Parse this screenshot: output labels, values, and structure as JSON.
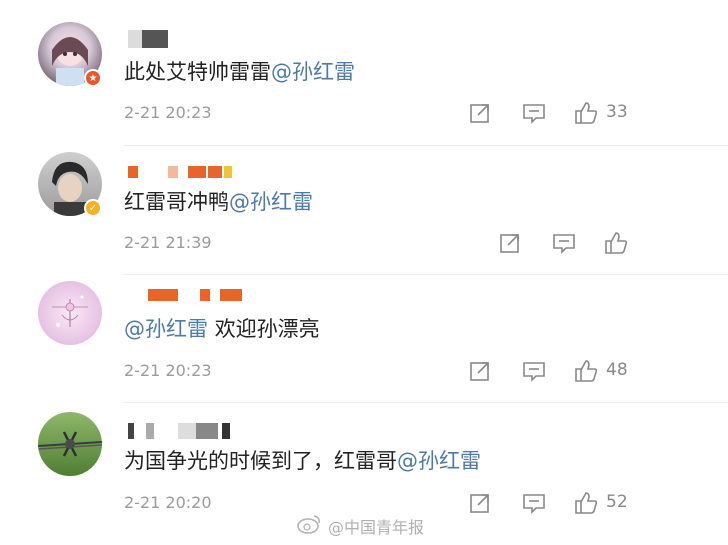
{
  "comments": [
    {
      "text": "此处艾特帅雷雷",
      "mention": "@孙红雷",
      "time": "2-21 20:23",
      "likes": "33"
    },
    {
      "text": "红雷哥冲鸭",
      "mention": "@孙红雷",
      "time": "2-21 21:39",
      "likes": ""
    },
    {
      "text": "欢迎孙漂亮",
      "mention": "@孙红雷",
      "time": "2-21 20:23",
      "likes": "48"
    },
    {
      "text": "为国争光的时候到了，红雷哥",
      "mention": "@孙红雷",
      "time": "2-21 20:20",
      "likes": "52"
    }
  ],
  "watermark": {
    "text": "@中国青年报"
  },
  "icons": {
    "share": "share-icon",
    "comment": "comment-icon",
    "like": "thumbs-up-icon",
    "vip": "vip-badge-icon"
  },
  "colors": {
    "mention": "#4c7aa9",
    "time": "#9b9b9b",
    "redacted": "#e8642a"
  }
}
